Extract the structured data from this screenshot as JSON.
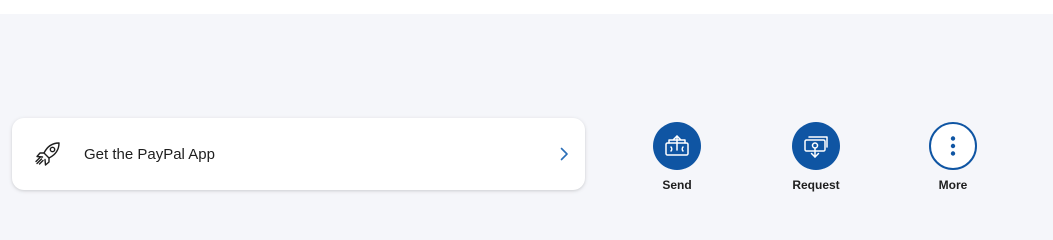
{
  "app_card": {
    "label": "Get the PayPal App",
    "icon": "rocket-icon",
    "chevron_icon": "chevron-right-icon"
  },
  "actions": [
    {
      "label": "Send",
      "icon": "send-money-icon"
    },
    {
      "label": "Request",
      "icon": "request-money-icon"
    },
    {
      "label": "More",
      "icon": "more-vertical-icon"
    }
  ],
  "colors": {
    "accent": "#0f55a3",
    "background": "#f5f6fa",
    "card": "#ffffff",
    "text": "#1e1e1e",
    "chevron": "#2b6fb8"
  }
}
